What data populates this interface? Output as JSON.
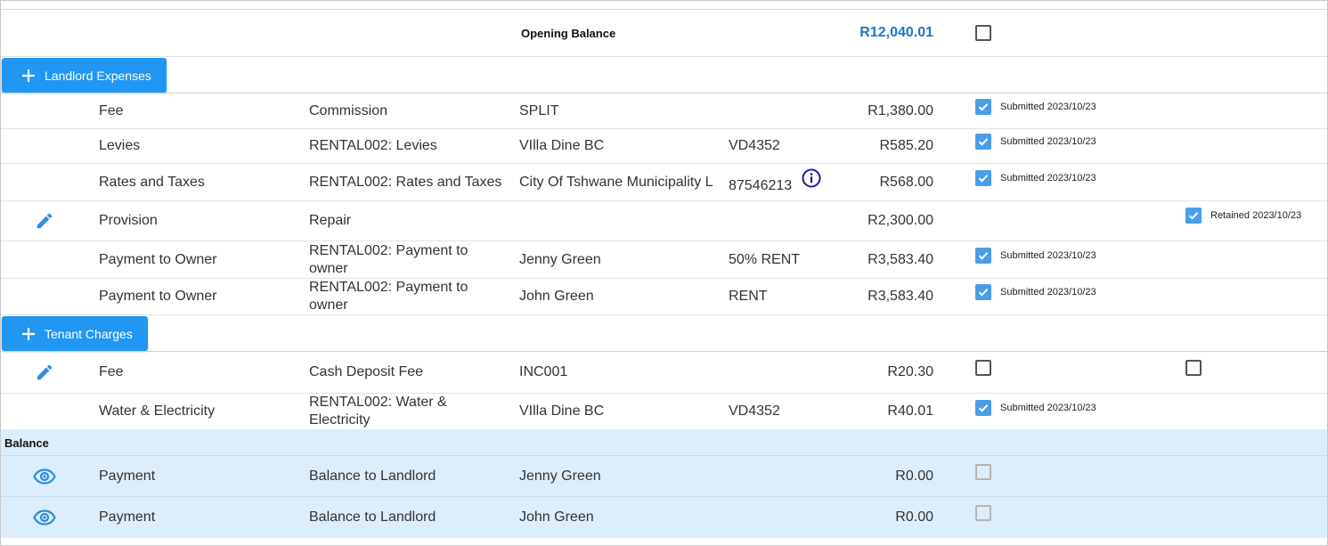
{
  "opening_balance": {
    "label": "Opening Balance",
    "value": "R12,040.01",
    "checked": false
  },
  "landlord_expenses": {
    "button_label": "Landlord Expenses",
    "rows": [
      {
        "type": "Fee",
        "description": "Commission",
        "payee": "SPLIT",
        "reference": "",
        "amount": "R1,380.00",
        "status": "Submitted 2023/10/23"
      },
      {
        "type": "Levies",
        "description": "RENTAL002: Levies",
        "payee": "VIlla Dine BC",
        "reference": "VD4352",
        "amount": "R585.20",
        "status": "Submitted 2023/10/23"
      },
      {
        "type": "Rates and Taxes",
        "description": "RENTAL002: Rates and Taxes",
        "payee": "City Of Tshwane Municipality L",
        "reference": "87546213",
        "amount": "R568.00",
        "status": "Submitted 2023/10/23"
      },
      {
        "type": "Provision",
        "description": "Repair",
        "payee": "",
        "reference": "",
        "amount": "R2,300.00",
        "status": "Retained 2023/10/23"
      },
      {
        "type": "Payment to Owner",
        "description": "RENTAL002: Payment to owner",
        "payee": "Jenny Green",
        "reference": "50% RENT",
        "amount": "R3,583.40",
        "status": "Submitted 2023/10/23"
      },
      {
        "type": "Payment to Owner",
        "description": "RENTAL002: Payment to owner",
        "payee": "John Green",
        "reference": "RENT",
        "amount": "R3,583.40",
        "status": "Submitted 2023/10/23"
      }
    ]
  },
  "tenant_charges": {
    "button_label": "Tenant Charges",
    "rows": [
      {
        "type": "Fee",
        "description": "Cash Deposit Fee",
        "payee": "INC001",
        "reference": "",
        "amount": "R20.30",
        "status": ""
      },
      {
        "type": "Water & Electricity",
        "description": "RENTAL002: Water & Electricity",
        "payee": "VIlla Dine BC",
        "reference": "VD4352",
        "amount": "R40.01",
        "status": "Submitted 2023/10/23"
      }
    ]
  },
  "balance": {
    "heading": "Balance",
    "rows": [
      {
        "type": "Payment",
        "description": "Balance to Landlord",
        "payee": "Jenny Green",
        "amount": "R0.00"
      },
      {
        "type": "Payment",
        "description": "Balance to Landlord",
        "payee": "John Green",
        "amount": "R0.00"
      }
    ]
  },
  "colors": {
    "accent": "#2196f3",
    "checkbox": "#4a9ee8",
    "amount_blue": "#1a78c8",
    "balance_bg": "#dcedfb",
    "info_icon": "#1a1aa8"
  },
  "icons": {
    "add": "plus-icon",
    "edit": "pencil-icon",
    "view": "eye-icon",
    "info": "info-icon",
    "check": "check-icon"
  }
}
